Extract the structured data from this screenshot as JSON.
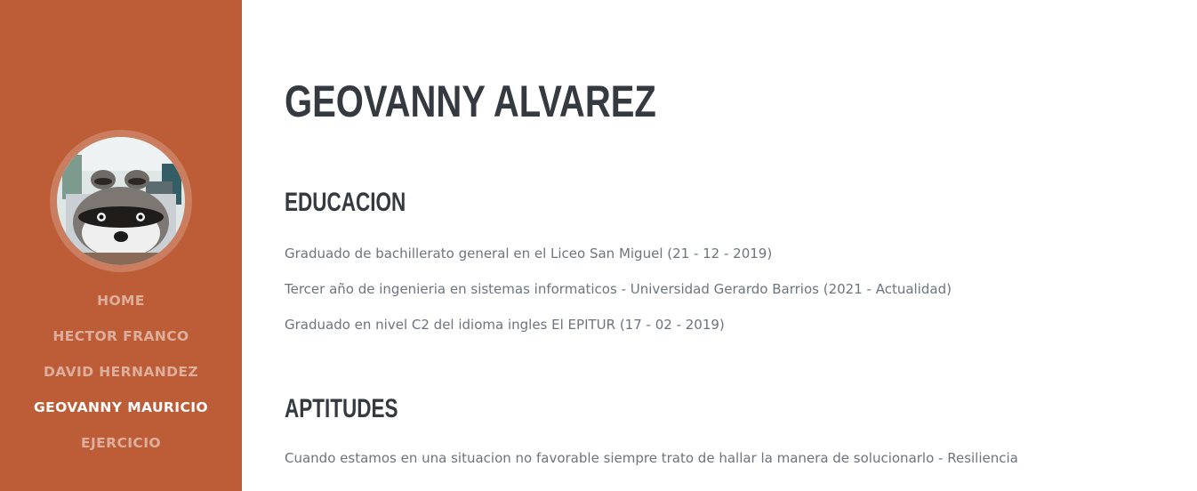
{
  "sidebar": {
    "avatar": {
      "alt": "raccoon-bedding-photo"
    },
    "nav": [
      {
        "label": "HOME"
      },
      {
        "label": "HECTOR FRANCO"
      },
      {
        "label": "DAVID HERNANDEZ"
      },
      {
        "label": "GEOVANNY MAURICIO",
        "active": true
      },
      {
        "label": "EJERCICIO"
      }
    ]
  },
  "main": {
    "name": "GEOVANNY ALVAREZ",
    "education": {
      "title": "EDUCACION",
      "items": [
        "Graduado de bachillerato general en el Liceo San Miguel (21 - 12 - 2019)",
        "Tercer año de ingenieria en sistemas informaticos - Universidad Gerardo Barrios (2021 - Actualidad)",
        "Graduado en nivel C2 del idioma ingles El EPITUR (17 - 02 - 2019)"
      ]
    },
    "skills": {
      "title": "APTITUDES",
      "items": [
        "Cuando estamos en una situacion no favorable siempre trato de hallar la manera de solucionarlo - Resiliencia"
      ]
    }
  },
  "colors": {
    "sidebar_bg": "#bd5d38",
    "heading": "#343a40",
    "body_text": "#6c757d"
  }
}
